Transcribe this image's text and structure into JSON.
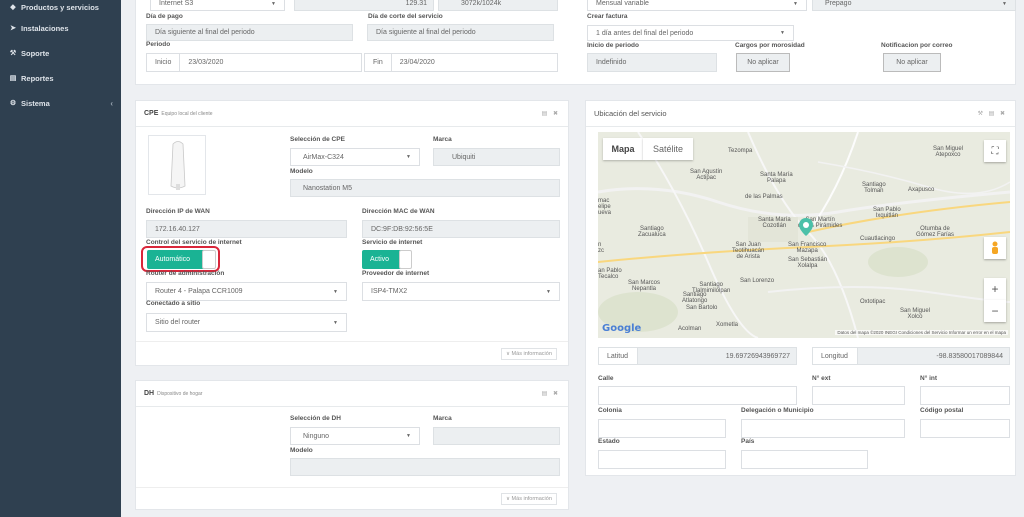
{
  "sidebar": {
    "items": [
      {
        "icon": "tags-icon",
        "glyph": "◆",
        "label": "Productos y servicios"
      },
      {
        "icon": "rocket-icon",
        "glyph": "➤",
        "label": "Instalaciones"
      },
      {
        "icon": "wrench-icon",
        "glyph": "⚒",
        "label": "Soporte"
      },
      {
        "icon": "book-icon",
        "glyph": "▤",
        "label": "Reportes"
      },
      {
        "icon": "cogs-icon",
        "glyph": "⚙",
        "label": "Sistema",
        "chevron": "‹"
      }
    ]
  },
  "top": {
    "plan_value": "Internet S3",
    "price_value": "129.31",
    "speed_value": "3072k/1024k",
    "billing_value": "Mensual variable",
    "payment_mode_value": "Prepago",
    "dia_pago_label": "Día de pago",
    "dia_pago_value": "Día siguiente al final del periodo",
    "dia_corte_label": "Día de corte del servicio",
    "dia_corte_value": "Día siguiente al final del periodo",
    "crear_factura_label": "Crear factura",
    "crear_factura_value": "1 día antes del final del periodo",
    "periodo_label": "Periodo",
    "inicio_addon": "Inicio",
    "inicio_value": "23/03/2020",
    "fin_addon": "Fin",
    "fin_value": "23/04/2020",
    "inicio_periodo_label": "Inicio de periodo",
    "inicio_periodo_value": "Indefinido",
    "cargos_label": "Cargos por morosidad",
    "cargos_value": "No aplicar",
    "notif_label": "Notificacion por correo",
    "notif_value": "No aplicar"
  },
  "cpe": {
    "title": "CPE",
    "subtitle": "Equipo local del cliente",
    "tools": "▤ ✖",
    "seleccion_label": "Selección de CPE",
    "seleccion_value": "AirMax-C324",
    "marca_label": "Marca",
    "marca_value": "Ubiquiti",
    "modelo_label": "Modelo",
    "modelo_value": "Nanostation M5",
    "ip_label": "Dirección IP de WAN",
    "ip_value": "172.16.40.127",
    "mac_label": "Dirección MAC de WAN",
    "mac_value": "DC:9F:DB:92:56:5E",
    "control_label": "Control del servicio de internet",
    "control_value": "Automático",
    "servicio_label": "Servicio de internet",
    "servicio_value": "Activo",
    "router_label": "Router de administración",
    "router_value": "Router 4 - Palapa CCR1009",
    "proveedor_label": "Proveedor de internet",
    "proveedor_value": "ISP4-TMX2",
    "conectado_label": "Conectado a sitio",
    "conectado_value": "Sitio del router",
    "more": "∨ Más información"
  },
  "dh": {
    "title": "DH",
    "subtitle": "Dispositivo de hogar",
    "tools": "▤ ✖",
    "seleccion_label": "Selección de DH",
    "seleccion_value": "Ninguno",
    "marca_label": "Marca",
    "marca_value": "",
    "modelo_label": "Modelo",
    "modelo_value": "",
    "more": "∨ Más información"
  },
  "ubicacion": {
    "title": "Ubicación del servicio",
    "tools": "⚒ ▤ ✖",
    "map": {
      "tab_map": "Mapa",
      "tab_sat": "Satélite",
      "google": "Google",
      "attribution": "Datos del mapa ©2020 INEGI   Condiciones del Servicio   Informar un error en el mapa",
      "places": {
        "tezompa": "Tezompa",
        "san_miguel": "San Miguel\nAtepoxco",
        "san_agustin": "San Agustín\nActipac",
        "santa_maria_palapa": "Santa María\nPalapa",
        "santiago_tolman": "Santiago\nTolman",
        "axapusco": "Axapusco",
        "san_pablo": "San Pablo\nIxquitlán",
        "santa_maria_cozotlan": "Santa María\nCozotlán",
        "san_martin": "San Martín\nde las Pirámides",
        "otumba": "Otumba de\nGómez Farías",
        "santiago_zacualuca": "Santiago\nZacualuca",
        "san_juan": "San Juan\nTeotihuacán\nde Arista",
        "san_francisco": "San Francisco\nMazapa",
        "san_sebastian": "San Sebastián\nXolalpa",
        "cuautlacingo": "Cuautlacingo",
        "san_marcos": "San Marcos\nNepantla",
        "santiago_tlal": "Santiago\nTlalmimilolpan",
        "san_lorenzo": "San Lorenzo",
        "santiago_atlatongo": "Santiago\nAtlatongo",
        "san_bartolo": "San Bartolo",
        "oxtotipac": "Oxtotipac",
        "san_miguel_xolco": "San Miguel\nXolco",
        "acolman": "Acolman",
        "xometla": "Xometla",
        "san_pablo_tecalco": "an Pablo\nTecalco",
        "mac": "mac\nelipe\nueva",
        "zc": "n\nzc",
        "de_las_palmas": "de las Palmas"
      },
      "roads": [
        "132",
        "142",
        "132",
        "132",
        "132",
        "132",
        "132"
      ]
    },
    "latitud_label": "Latitud",
    "latitud_value": "19.69726943969727",
    "longitud_label": "Longitud",
    "longitud_value": "-98.83580017089844",
    "calle_label": "Calle",
    "next_label": "N° ext",
    "nint_label": "N° int",
    "colonia_label": "Colonia",
    "delegacion_label": "Delegación o Municipio",
    "cp_label": "Código postal",
    "estado_label": "Estado",
    "pais_label": "País"
  },
  "colors": {
    "accent": "#1ab394",
    "sidebar": "#2f4050",
    "highlight": "#d9263a",
    "marker": "#1ab394"
  }
}
